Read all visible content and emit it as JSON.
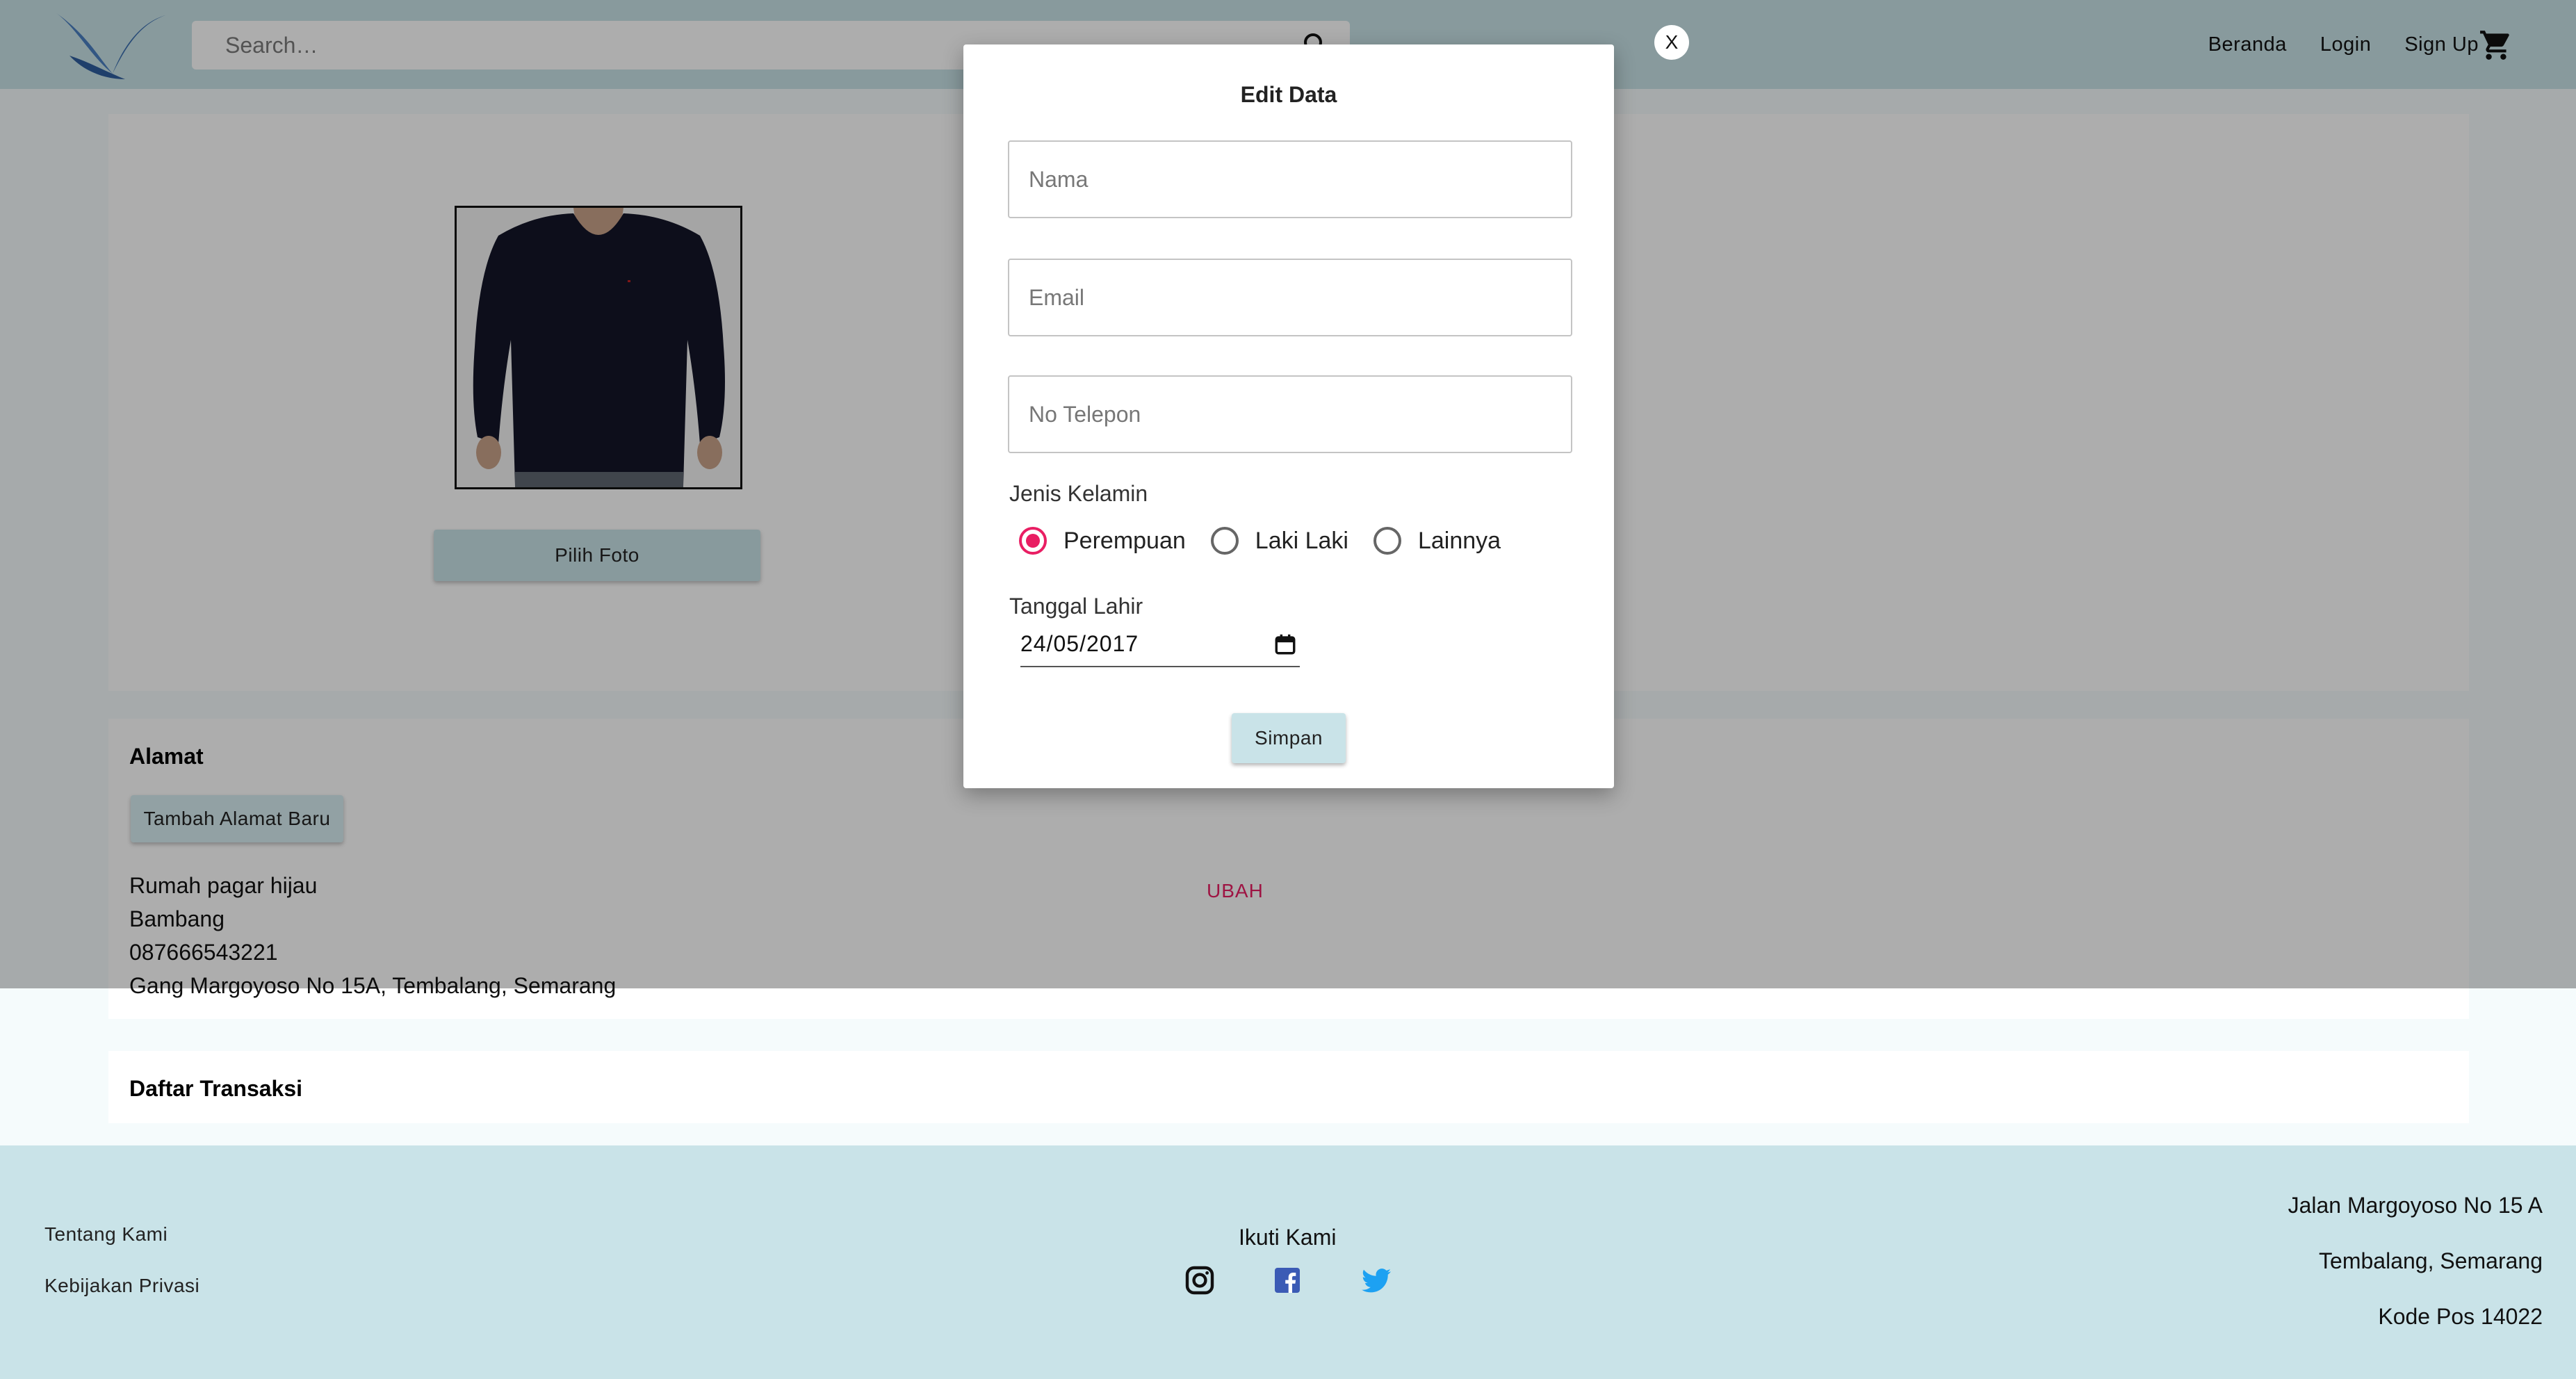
{
  "header": {
    "search_placeholder": "Search…",
    "nav": {
      "home": "Beranda",
      "login": "Login",
      "signup": "Sign Up"
    }
  },
  "profile": {
    "pick_photo_label": "Pilih Foto"
  },
  "address": {
    "title": "Alamat",
    "add_button": "Tambah Alamat Baru",
    "label": "Rumah pagar hijau",
    "name": "Bambang",
    "phone": "087666543221",
    "street": "Gang Margoyoso No 15A, Tembalang, Semarang",
    "change_link": "UBAH"
  },
  "transactions": {
    "title": "Daftar Transaksi"
  },
  "footer": {
    "about": "Tentang Kami",
    "privacy": "Kebijakan Privasi",
    "follow": "Ikuti Kami",
    "address_line1": "Jalan Margoyoso No 15 A",
    "address_line2": "Tembalang, Semarang",
    "address_line3": "Kode Pos 14022"
  },
  "modal": {
    "close_label": "X",
    "title": "Edit Data",
    "name_placeholder": "Nama",
    "email_placeholder": "Email",
    "phone_placeholder": "No Telepon",
    "gender_label": "Jenis Kelamin",
    "gender_options": [
      "Perempuan",
      "Laki Laki",
      "Lainnya"
    ],
    "gender_selected": "Perempuan",
    "birthdate_label": "Tanggal Lahir",
    "birthdate_value": "24/05/2017",
    "save_label": "Simpan"
  },
  "colors": {
    "header_bg": "#c9e3e8",
    "accent": "#e91e63",
    "footer_bg": "#c9e3e8"
  },
  "icons": [
    "bird-logo",
    "search-icon",
    "cart-icon",
    "instagram-icon",
    "facebook-icon",
    "twitter-icon",
    "calendar-icon"
  ]
}
